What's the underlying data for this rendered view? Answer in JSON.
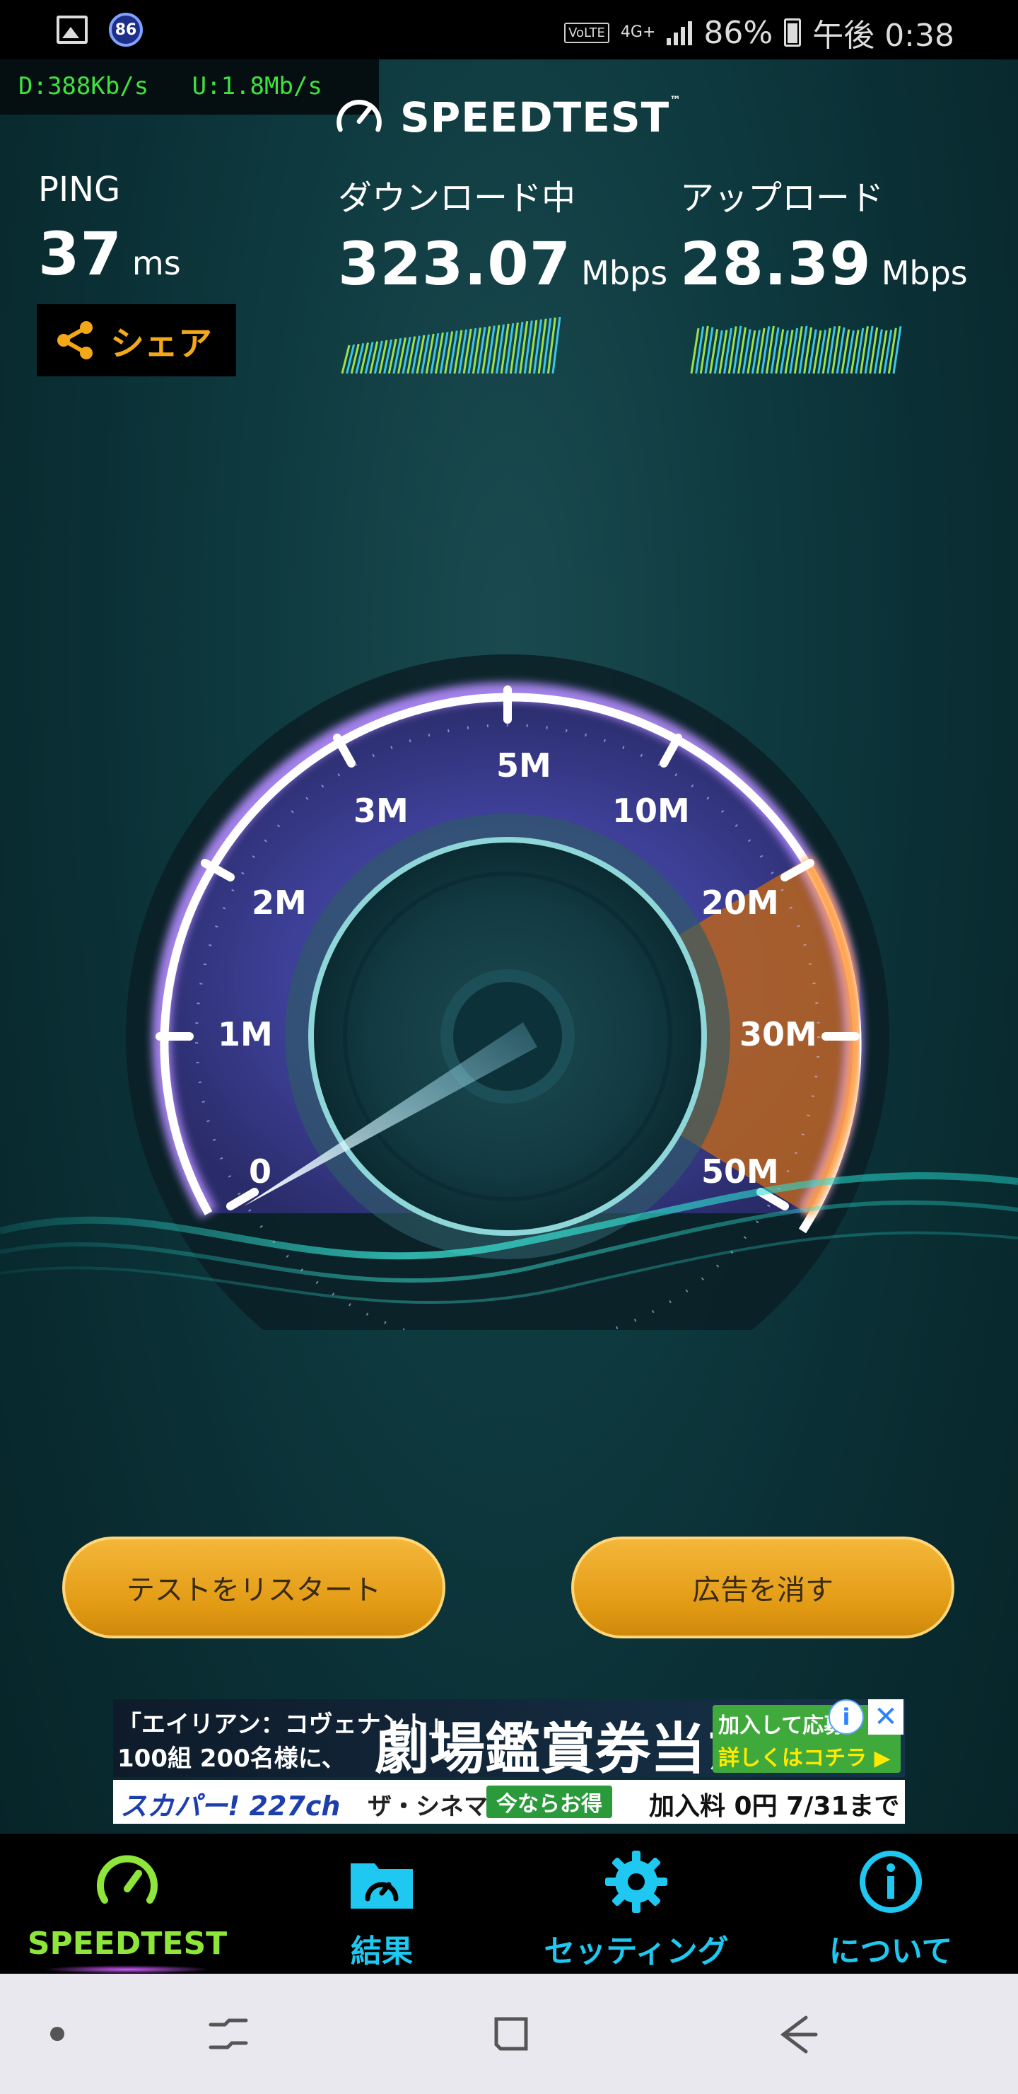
{
  "status_bar": {
    "notification_badge": "86",
    "volte": "VoLTE",
    "network": "4G+",
    "battery": "86%",
    "time": "午後 0:38"
  },
  "debug": {
    "download_rate": "D:388Kb/s",
    "upload_rate": "U:1.8Mb/s"
  },
  "header": {
    "logo_text": "SPEEDTEST",
    "logo_tm": "™"
  },
  "ping": {
    "label": "PING",
    "value": "37",
    "unit": "ms"
  },
  "download": {
    "label": "ダウンロード中",
    "value": "323.07",
    "unit": "Mbps"
  },
  "upload": {
    "label": "アップロード",
    "value": "28.39",
    "unit": "Mbps"
  },
  "share": {
    "label": "シェア"
  },
  "gauge": {
    "tick_labels": [
      "0",
      "1M",
      "2M",
      "3M",
      "5M",
      "10M",
      "20M",
      "30M",
      "50M"
    ],
    "needle_value": "0",
    "accent": "#f08a2a",
    "ring": "#c7a6ff"
  },
  "buttons": {
    "restart": "テストをリスタート",
    "remove_ads": "広告を消す"
  },
  "ad": {
    "line1": "「エイリアン：コヴェナント」",
    "line2": "100組 200名様に、",
    "headline": "劇場鑑賞券当たる!",
    "cta_a": "加入して応募",
    "cta_b": "詳しくはコチラ ▶",
    "bottom_brand": "スカパー! 227ch",
    "bottom_channel": "ザ・シネマ",
    "bottom_deal": "今ならお得",
    "bottom_price": "加入料 0円 7/31まで",
    "info": "i",
    "close": "✕"
  },
  "nav": {
    "items": [
      {
        "label": "SPEEDTEST",
        "icon": "speedometer-icon",
        "active": true
      },
      {
        "label": "結果",
        "icon": "results-folder-icon",
        "active": false
      },
      {
        "label": "セッティング",
        "icon": "gear-icon",
        "active": false
      },
      {
        "label": "について",
        "icon": "info-icon",
        "active": false
      }
    ],
    "active_color": "#8fe63a",
    "color": "#1ec8f0"
  }
}
